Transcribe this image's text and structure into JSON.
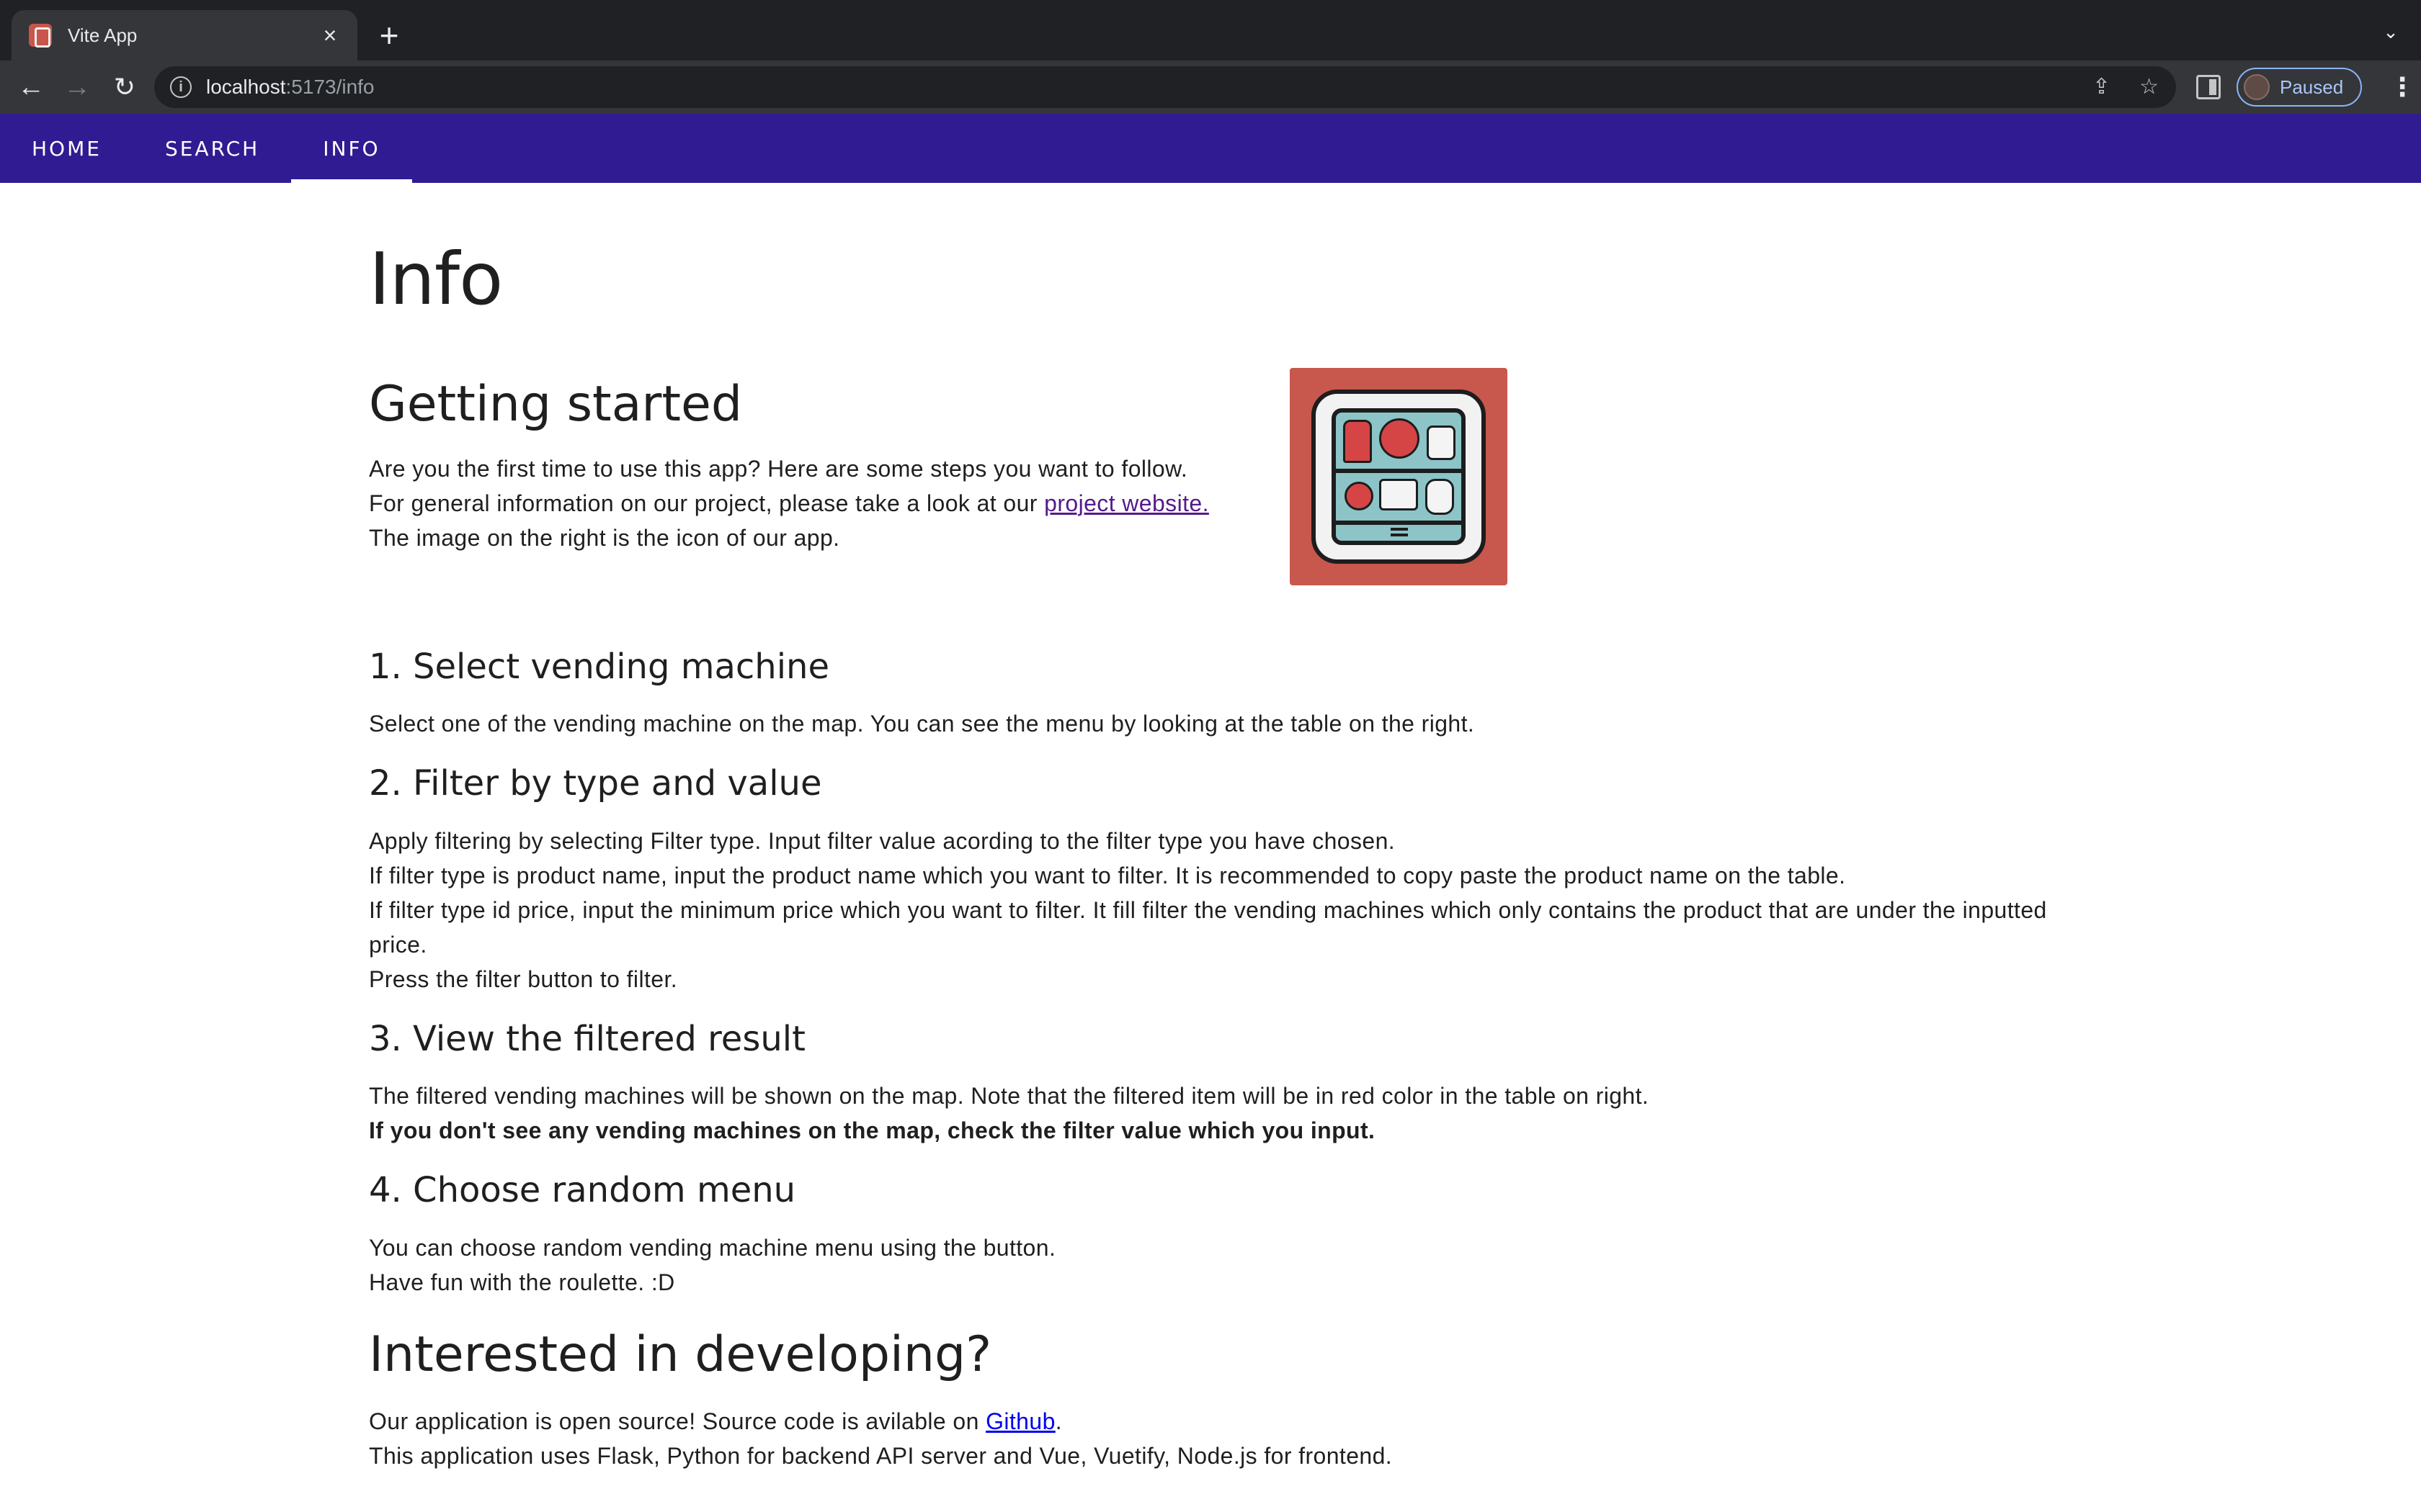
{
  "browser": {
    "tab_title": "Vite App",
    "tab_close": "×",
    "new_tab": "+",
    "url_host": "localhost",
    "url_path": ":5173/info",
    "profile_status": "Paused"
  },
  "nav": {
    "tabs": [
      {
        "label": "HOME"
      },
      {
        "label": "SEARCH"
      },
      {
        "label": "INFO",
        "active": true
      }
    ]
  },
  "page": {
    "title": "Info",
    "getting_started": {
      "heading": "Getting started",
      "line1": "Are you the first time to use this app? Here are some steps you want to follow.",
      "line2_prefix": "For general information on our project, please take a look at our ",
      "line2_link": "project website.",
      "line3": "The image on the right is the icon of our app."
    },
    "steps": [
      {
        "heading": "1. Select vending machine",
        "lines": [
          "Select one of the vending machine on the map. You can see the menu by looking at the table on the right."
        ]
      },
      {
        "heading": "2. Filter by type and value",
        "lines": [
          "Apply filtering by selecting Filter type. Input filter value acording to the filter type you have chosen.",
          "If filter type is product name, input the product name which you want to filter. It is recommended to copy paste the product name on the table.",
          "If filter type id price, input the minimum price which you want to filter. It fill filter the vending machines which only contains the product that are under the inputted price.",
          "Press the filter button to filter."
        ]
      },
      {
        "heading": "3. View the filtered result",
        "lines": [
          "The filtered vending machines will be shown on the map. Note that the filtered item will be in red color in the table on right."
        ],
        "bold_line": "If you don't see any vending machines on the map, check the filter value which you input."
      },
      {
        "heading": "4. Choose random menu",
        "lines": [
          "You can choose random vending machine menu using the button.",
          "Have fun with the roulette. :D"
        ]
      }
    ],
    "developing": {
      "heading": "Interested in developing?",
      "line1_prefix": "Our application is open source! Source code is avilable on ",
      "line1_link": "Github",
      "line1_suffix": ".",
      "line2": "This application uses Flask, Python for backend API server and Vue, Vuetify, Node.js for frontend."
    }
  },
  "colors": {
    "appbar": "#311b92",
    "app_icon_bg": "#c8574d"
  }
}
